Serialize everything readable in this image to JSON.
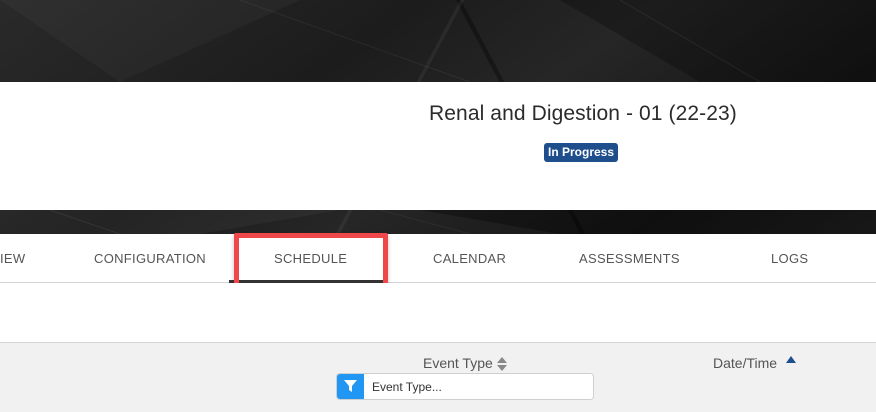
{
  "course": {
    "title": "Renal and Digestion - 01 (22-23)",
    "status": "In Progress"
  },
  "tabs": [
    {
      "label": "IEW"
    },
    {
      "label": "CONFIGURATION"
    },
    {
      "label": "SCHEDULE",
      "active": true
    },
    {
      "label": "CALENDAR"
    },
    {
      "label": "ASSESSMENTS"
    },
    {
      "label": "LOGS"
    }
  ],
  "table": {
    "columns": [
      {
        "label": "Event Type",
        "sort": "sortable"
      },
      {
        "label": "Date/Time",
        "sort": "ascending"
      }
    ],
    "filter": {
      "placeholder": "Event Type...",
      "value": ""
    }
  },
  "colors": {
    "accent": "#2196f3",
    "status_badge": "#1f4e8c",
    "highlight": "#f0474a"
  }
}
